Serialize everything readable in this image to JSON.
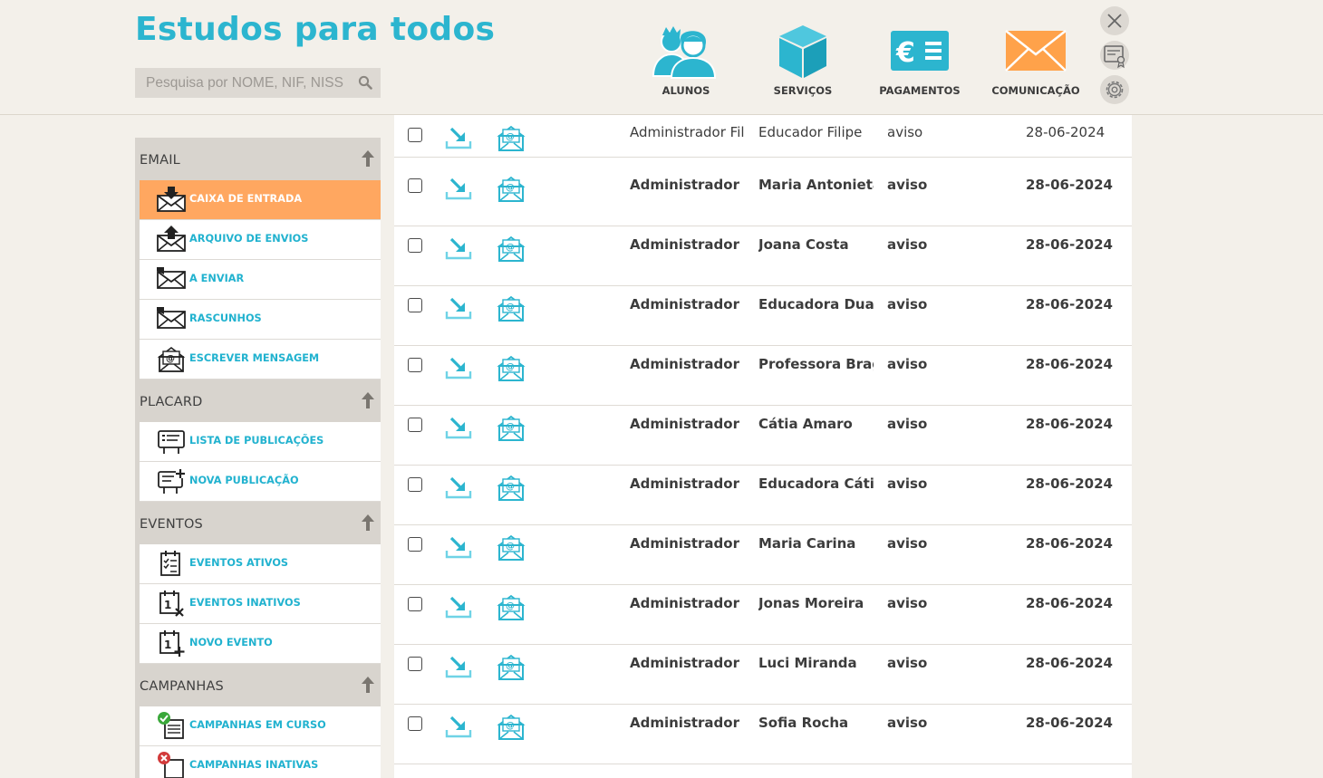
{
  "header": {
    "title": "Estudos para todos",
    "search_placeholder": "Pesquisa por NOME, NIF, NISS",
    "nav": [
      {
        "label": "ALUNOS",
        "icon": "students-icon",
        "color": "#2cb5cf"
      },
      {
        "label": "SERVIÇOS",
        "icon": "box-icon",
        "color": "#2cb5cf"
      },
      {
        "label": "PAGAMENTOS",
        "icon": "euro-icon",
        "color": "#2cb5cf"
      },
      {
        "label": "COMUNICAÇÃO",
        "icon": "envelope-icon",
        "color": "#ffa24a"
      }
    ],
    "right_icons": [
      "close-icon",
      "certificate-icon",
      "gear-icon"
    ]
  },
  "sidebar": {
    "sections": [
      {
        "title": "EMAIL",
        "items": [
          {
            "label": "CAIXA DE ENTRADA",
            "icon": "inbox-icon",
            "active": true
          },
          {
            "label": "ARQUIVO DE ENVIOS",
            "icon": "outbox-icon"
          },
          {
            "label": "A ENVIAR",
            "icon": "sending-icon"
          },
          {
            "label": "RASCUNHOS",
            "icon": "drafts-icon"
          },
          {
            "label": "ESCREVER MENSAGEM",
            "icon": "compose-icon"
          }
        ]
      },
      {
        "title": "PLACARD",
        "items": [
          {
            "label": "LISTA DE PUBLICAÇÕES",
            "icon": "board-list-icon"
          },
          {
            "label": "NOVA PUBLICAÇÃO",
            "icon": "board-new-icon"
          }
        ]
      },
      {
        "title": "EVENTOS",
        "items": [
          {
            "label": "EVENTOS ATIVOS",
            "icon": "calendar-check-icon"
          },
          {
            "label": "EVENTOS INATIVOS",
            "icon": "calendar-x-icon"
          },
          {
            "label": "NOVO EVENTO",
            "icon": "calendar-plus-icon"
          }
        ]
      },
      {
        "title": "CAMPANHAS",
        "items": [
          {
            "label": "CAMPANHAS EM CURSO",
            "icon": "campaign-active-icon"
          },
          {
            "label": "CAMPANHAS INATIVAS",
            "icon": "campaign-inactive-icon"
          }
        ]
      }
    ]
  },
  "messages": {
    "rows": [
      {
        "from": "Administrador Filipe",
        "to": "Educador Filipe",
        "type": "aviso",
        "date": "28-06-2024",
        "unread": false
      },
      {
        "from": "Administrador Filipe",
        "to": "Maria Antonieta",
        "type": "aviso",
        "date": "28-06-2024",
        "unread": true
      },
      {
        "from": "Administrador Filipe",
        "to": "Joana Costa",
        "type": "aviso",
        "date": "28-06-2024",
        "unread": true
      },
      {
        "from": "Administrador Filipe",
        "to": "Educadora Duarte",
        "type": "aviso",
        "date": "28-06-2024",
        "unread": true
      },
      {
        "from": "Administrador Filipe",
        "to": "Professora Braga",
        "type": "aviso",
        "date": "28-06-2024",
        "unread": true
      },
      {
        "from": "Administrador Filipe",
        "to": "Cátia Amaro",
        "type": "aviso",
        "date": "28-06-2024",
        "unread": true
      },
      {
        "from": "Administrador Filipe",
        "to": "Educadora Cátia",
        "type": "aviso",
        "date": "28-06-2024",
        "unread": true
      },
      {
        "from": "Administrador Filipe",
        "to": "Maria Carina",
        "type": "aviso",
        "date": "28-06-2024",
        "unread": true
      },
      {
        "from": "Administrador Filipe",
        "to": "Jonas Moreira",
        "type": "aviso",
        "date": "28-06-2024",
        "unread": true
      },
      {
        "from": "Administrador Filipe",
        "to": "Luci Miranda",
        "type": "aviso",
        "date": "28-06-2024",
        "unread": true
      },
      {
        "from": "Administrador Filipe",
        "to": "Sofia Rocha",
        "type": "aviso",
        "date": "28-06-2024",
        "unread": true
      }
    ]
  },
  "colors": {
    "accent": "#2cb5cf",
    "active_item": "#ffa760",
    "background": "#f3f0ea",
    "sidebar": "#d8d4ce"
  }
}
